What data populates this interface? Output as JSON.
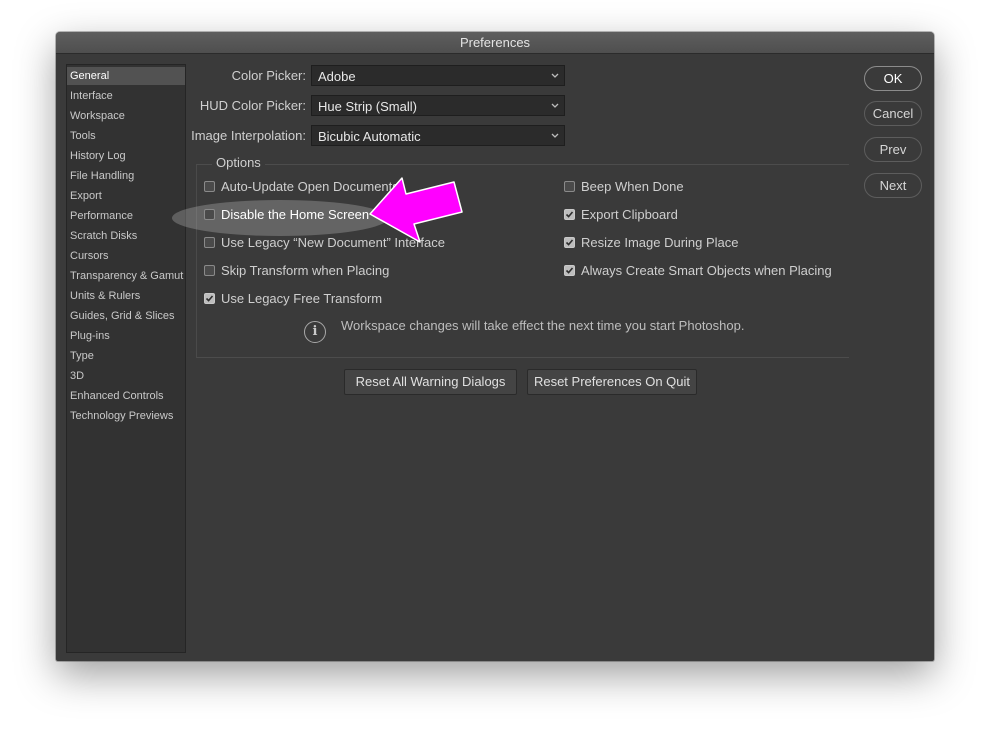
{
  "window": {
    "title": "Preferences"
  },
  "sidebar": {
    "items": [
      "General",
      "Interface",
      "Workspace",
      "Tools",
      "History Log",
      "File Handling",
      "Export",
      "Performance",
      "Scratch Disks",
      "Cursors",
      "Transparency & Gamut",
      "Units & Rulers",
      "Guides, Grid & Slices",
      "Plug-ins",
      "Type",
      "3D",
      "Enhanced Controls",
      "Technology Previews"
    ],
    "selected": "General"
  },
  "fields": {
    "color_picker": {
      "label": "Color Picker:",
      "value": "Adobe"
    },
    "hud_color_picker": {
      "label": "HUD Color Picker:",
      "value": "Hue Strip (Small)"
    },
    "image_interpolation": {
      "label": "Image Interpolation:",
      "value": "Bicubic Automatic"
    }
  },
  "options": {
    "title": "Options",
    "left": [
      {
        "label": "Auto-Update Open Documents",
        "checked": false
      },
      {
        "label": "Disable the Home Screen",
        "checked": false
      },
      {
        "label": "Use Legacy “New Document” Interface",
        "checked": false
      },
      {
        "label": "Skip Transform when Placing",
        "checked": false
      },
      {
        "label": "Use Legacy Free Transform",
        "checked": true
      }
    ],
    "right": [
      {
        "label": "Beep When Done",
        "checked": false
      },
      {
        "label": "Export Clipboard",
        "checked": true
      },
      {
        "label": "Resize Image During Place",
        "checked": true
      },
      {
        "label": "Always Create Smart Objects when Placing",
        "checked": true
      }
    ],
    "info": "Workspace changes will take effect the next time you start Photoshop."
  },
  "buttons": {
    "reset_warnings": "Reset All Warning Dialogs",
    "reset_prefs": "Reset Preferences On Quit",
    "ok": "OK",
    "cancel": "Cancel",
    "prev": "Prev",
    "next": "Next"
  },
  "colors": {
    "window_bg": "#3a3a3a",
    "annotation_arrow": "#ff00ff"
  }
}
